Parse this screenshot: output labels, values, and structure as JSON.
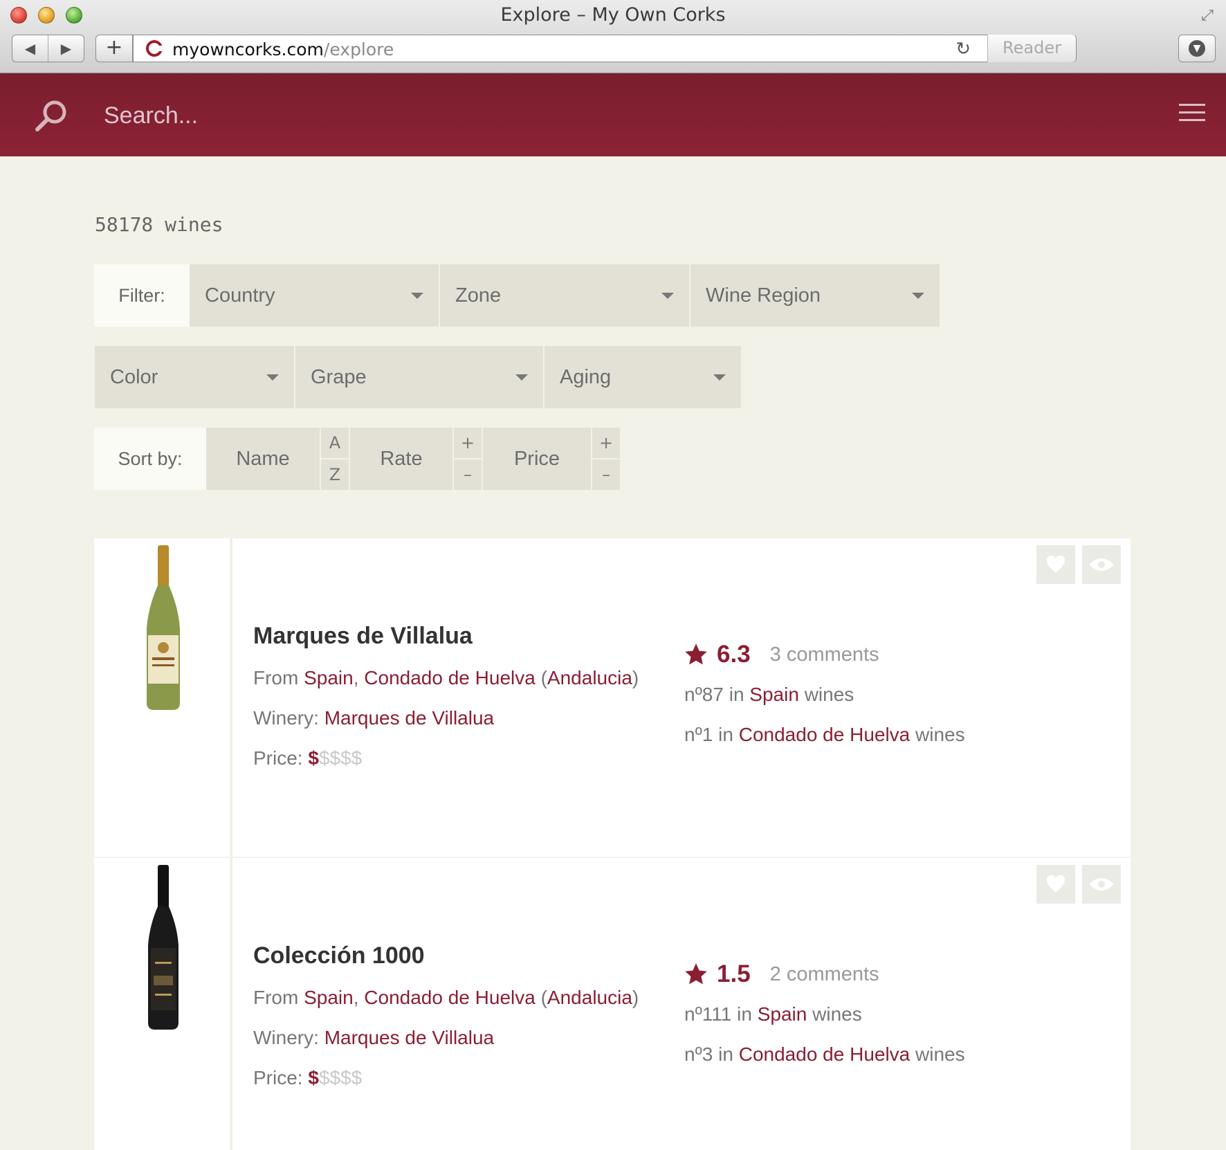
{
  "window": {
    "title": "Explore – My Own Corks",
    "url_host": "myowncorks.com",
    "url_path": "/explore",
    "reader_label": "Reader"
  },
  "header": {
    "search_placeholder": "Search...",
    "brand_color": "#8a1f33"
  },
  "results": {
    "count_text": "58178 wines"
  },
  "filters": {
    "label": "Filter:",
    "row1": [
      "Country",
      "Zone",
      "Wine Region"
    ],
    "row2": [
      "Color",
      "Grape",
      "Aging"
    ]
  },
  "sort": {
    "label": "Sort by:",
    "name": {
      "label": "Name",
      "up": "A",
      "down": "Z"
    },
    "rate": {
      "label": "Rate",
      "up": "+",
      "down": "–"
    },
    "price": {
      "label": "Price",
      "up": "+",
      "down": "–"
    }
  },
  "wines": [
    {
      "name": "Marques de Villalua",
      "from_label": "From",
      "country": "Spain",
      "region": "Condado de Huelva",
      "area": "Andalucia",
      "winery_label": "Winery:",
      "winery": "Marques de Villalua",
      "price_label": "Price:",
      "price_on": "$",
      "price_off": "$$$$",
      "rating": "6.3",
      "comments": "3 comments",
      "rank_country_prefix": "nº87 in",
      "rank_region_prefix": "nº1 in",
      "wines_suffix": "wines",
      "bottle_color": "#8a9a4a"
    },
    {
      "name": "Colección 1000",
      "from_label": "From",
      "country": "Spain",
      "region": "Condado de Huelva",
      "area": "Andalucia",
      "winery_label": "Winery:",
      "winery": "Marques de Villalua",
      "price_label": "Price:",
      "price_on": "$",
      "price_off": "$$$$",
      "rating": "1.5",
      "comments": "2 comments",
      "rank_country_prefix": "nº111 in",
      "rank_region_prefix": "nº3 in",
      "wines_suffix": "wines",
      "bottle_color": "#1a1a1a"
    }
  ]
}
